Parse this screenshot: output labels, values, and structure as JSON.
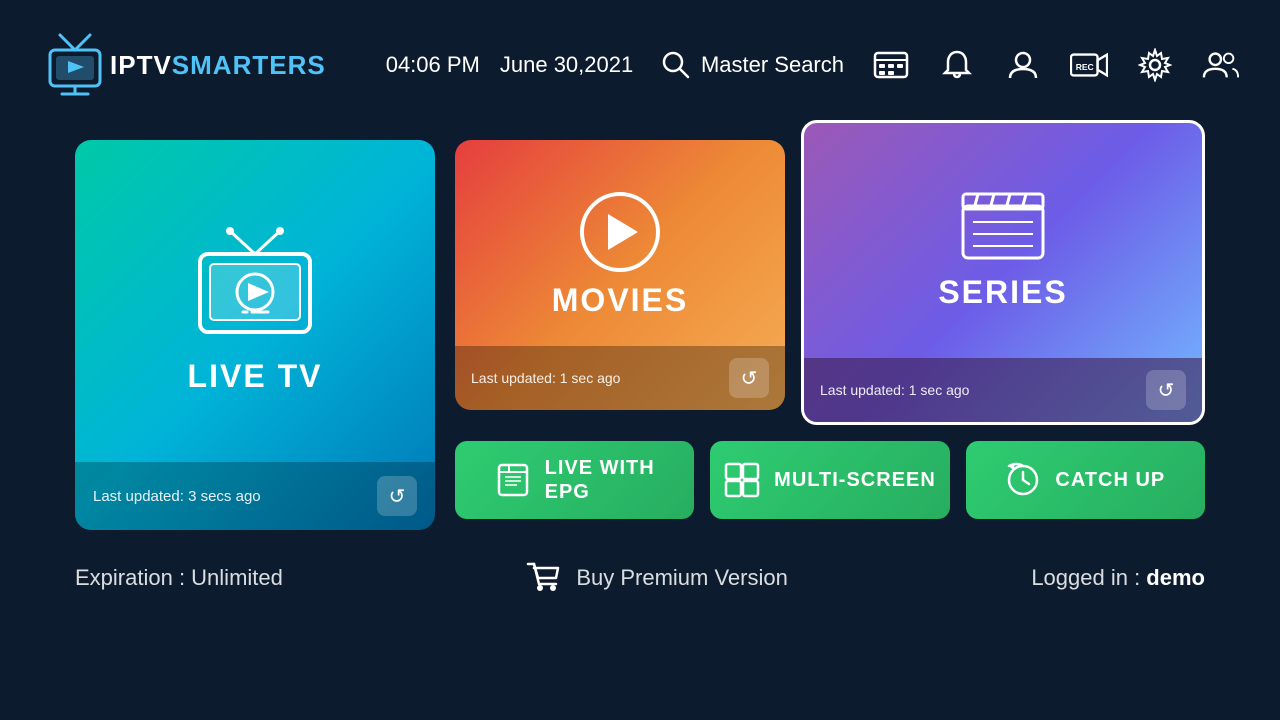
{
  "header": {
    "logo_iptv": "IPTV",
    "logo_smarters": "SMARTERS",
    "time": "04:06 PM",
    "date": "June 30,2021",
    "search_label": "Master Search"
  },
  "cards": {
    "live_tv": {
      "label": "LIVE TV",
      "last_updated": "Last updated: 3 secs ago"
    },
    "movies": {
      "label": "MOVIES",
      "last_updated": "Last updated: 1 sec ago"
    },
    "series": {
      "label": "SERIES",
      "last_updated": "Last updated: 1 sec ago"
    }
  },
  "bottom_buttons": {
    "live_epg": "LIVE WITH\nEPG",
    "live_epg_line1": "LIVE WITH",
    "live_epg_line2": "EPG",
    "multi_screen": "MULTI-SCREEN",
    "catch_up": "CATCH UP"
  },
  "footer": {
    "expiration": "Expiration : Unlimited",
    "buy_premium": "Buy Premium Version",
    "logged_in_label": "Logged in : ",
    "username": "demo"
  }
}
